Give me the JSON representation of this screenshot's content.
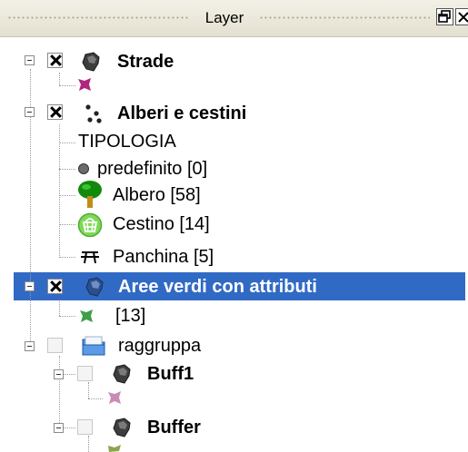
{
  "panel": {
    "title": "Layer",
    "float_button": "🗗",
    "close_button": "✕"
  },
  "layers": [
    {
      "name": "Strade",
      "checked": true,
      "icon": "polygon-layer-icon",
      "legend": [
        {
          "icon": "polygon-symbol-icon",
          "color": "#b0257e",
          "label": ""
        }
      ]
    },
    {
      "name": "Alberi e cestini",
      "checked": true,
      "icon": "point-layer-icon",
      "legend": [
        {
          "label": "TIPOLOGIA",
          "icon": ""
        },
        {
          "label": "predefinito [0]",
          "icon": "circle-symbol-icon"
        },
        {
          "label": "Albero [58]",
          "icon": "tree-icon"
        },
        {
          "label": "Cestino [14]",
          "icon": "basket-icon"
        },
        {
          "label": "Panchina [5]",
          "icon": "bench-icon"
        }
      ]
    },
    {
      "name": "Aree verdi con attributi",
      "checked": true,
      "selected": true,
      "icon": "polygon-layer-icon",
      "legend": [
        {
          "label": "[13]",
          "icon": "polygon-symbol-icon",
          "color": "#3f9e4a"
        }
      ]
    },
    {
      "name": "raggruppa",
      "checked": false,
      "group": true,
      "icon": "group-folder-icon",
      "children": [
        {
          "name": "Buff1",
          "checked": false,
          "icon": "polygon-layer-icon",
          "legend": [
            {
              "icon": "polygon-symbol-icon",
              "color": "#c98bb6",
              "label": ""
            }
          ]
        },
        {
          "name": "Buffer",
          "checked": false,
          "icon": "polygon-layer-icon",
          "legend": [
            {
              "icon": "polygon-symbol-icon",
              "color": "#8aa54a",
              "label": ""
            }
          ]
        }
      ]
    }
  ]
}
